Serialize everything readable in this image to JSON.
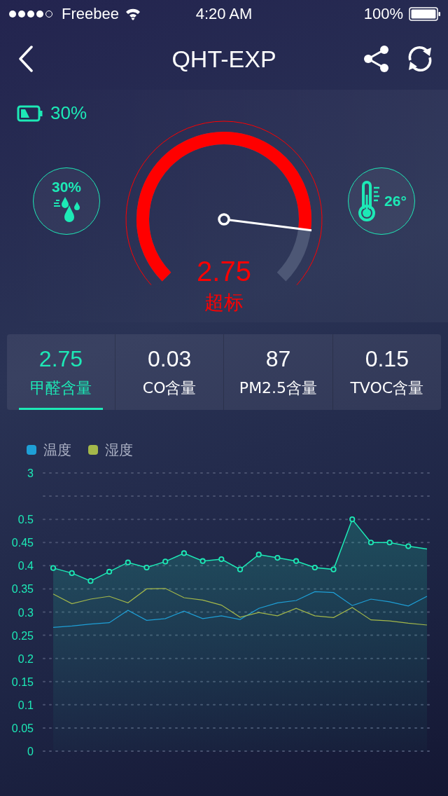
{
  "status_bar": {
    "carrier": "Freebee",
    "time": "4:20 AM",
    "battery": "100%"
  },
  "nav": {
    "title": "QHT-EXP"
  },
  "device_battery": "30%",
  "humidity": "30%",
  "temperature": "26°",
  "gauge": {
    "value": "2.75",
    "status": "超标"
  },
  "tabs": [
    {
      "value": "2.75",
      "label": "甲醛含量",
      "selected": true
    },
    {
      "value": "0.03",
      "label": "CO含量",
      "selected": false
    },
    {
      "value": "87",
      "label": "PM2.5含量",
      "selected": false
    },
    {
      "value": "0.15",
      "label": "TVOC含量",
      "selected": false
    }
  ],
  "chart": {
    "top_tick_label": "3",
    "chart_data": {
      "type": "line",
      "grid": true,
      "ylim": [
        0,
        0.6
      ],
      "yticks": [
        0,
        0.05,
        0.1,
        0.15,
        0.2,
        0.25,
        0.3,
        0.35,
        0.4,
        0.45,
        0.5
      ],
      "series": [
        {
          "type": "area",
          "marker": "circle",
          "color": "#1de9b6",
          "values": [
            0.395,
            0.384,
            0.367,
            0.387,
            0.407,
            0.396,
            0.409,
            0.427,
            0.41,
            0.414,
            0.392,
            0.424,
            0.417,
            0.41,
            0.396,
            0.392,
            0.5,
            0.45,
            0.45,
            0.442,
            0.436
          ]
        },
        {
          "name": "温度",
          "color": "#1e9fd6",
          "values": [
            0.267,
            0.27,
            0.274,
            0.277,
            0.304,
            0.282,
            0.286,
            0.302,
            0.286,
            0.292,
            0.284,
            0.308,
            0.32,
            0.325,
            0.344,
            0.342,
            0.314,
            0.328,
            0.322,
            0.313,
            0.334
          ]
        },
        {
          "name": "湿度",
          "color": "#a4b84a",
          "values": [
            0.339,
            0.318,
            0.328,
            0.334,
            0.32,
            0.35,
            0.351,
            0.331,
            0.326,
            0.315,
            0.289,
            0.299,
            0.292,
            0.308,
            0.292,
            0.288,
            0.31,
            0.283,
            0.281,
            0.276,
            0.272
          ]
        }
      ]
    }
  }
}
